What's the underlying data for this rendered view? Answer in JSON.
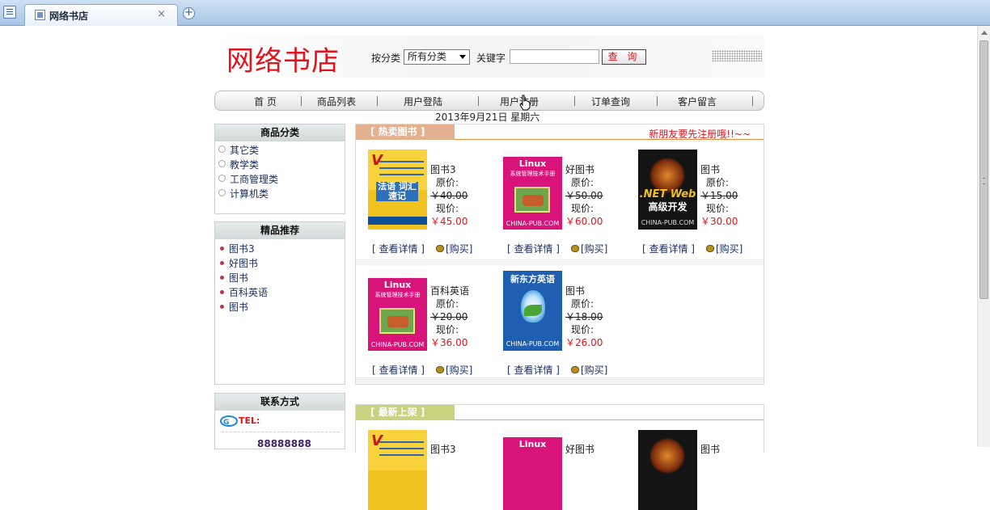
{
  "browser": {
    "tab_title": "网络书店",
    "tab_close": "×",
    "new_tab": "+"
  },
  "header": {
    "logo": "网络书店",
    "category_label": "按分类",
    "category_selected": "所有分类",
    "keyword_label": "关键字",
    "keyword_value": "",
    "query_button": "查 询"
  },
  "nav": {
    "items": [
      "首 页",
      "商品列表",
      "用户登陆",
      "用户注册",
      "订单查询",
      "客户留言"
    ]
  },
  "date_line": "2013年9月21日  星期六",
  "sidebar": {
    "categories_title": "商品分类",
    "categories": [
      "其它类",
      "教学类",
      "工商管理类",
      "计算机类"
    ],
    "recommend_title": "精品推荐",
    "recommend": [
      "图书3",
      "好图书",
      "图书",
      "百科英语",
      "图书"
    ],
    "contact_title": "联系方式",
    "tel_label": "TEL:",
    "tel_number": "88888888"
  },
  "hot_books": {
    "tag": "[ 热卖图书 ]",
    "note": "新朋友要先注册哦!!~~",
    "price_original_label": "原价:",
    "price_current_label": "现价:",
    "details_label": "[ 查看详情 ]",
    "buy_label": "[购买]",
    "books": [
      {
        "name": "图书3",
        "original": "￥40.00",
        "current": "￥45.00",
        "cover": "yellow"
      },
      {
        "name": "好图书",
        "original": "￥50.00",
        "current": "￥60.00",
        "cover": "pink"
      },
      {
        "name": "图书",
        "original": "￥15.00",
        "current": "￥30.00",
        "cover": "dark"
      },
      {
        "name": "百科英语",
        "original": "￥20.00",
        "current": "￥36.00",
        "cover": "pink"
      },
      {
        "name": "图书",
        "original": "￥18.00",
        "current": "￥26.00",
        "cover": "blue"
      }
    ]
  },
  "new_books": {
    "tag": "[ 最新上架 ]",
    "books": [
      {
        "name": "图书3",
        "cover": "yellow"
      },
      {
        "name": "好图书",
        "cover": "pink"
      },
      {
        "name": "图书",
        "cover": "dark"
      }
    ]
  },
  "covers": {
    "yellow": {
      "v": "V",
      "zh": "法语 词汇速记"
    },
    "pink": {
      "t1": "Linux",
      "t2": "系统管理技术手册",
      "url": "CHINA-PUB.COM"
    },
    "dark": {
      "net": ".NET Web",
      "dev": "高级开发",
      "url": "CHINA-PUB.COM"
    },
    "blue": {
      "hd": "新东方英语",
      "url": "CHINA-PUB.COM"
    }
  },
  "colors": {
    "brand_red": "#e0141c",
    "hot_tag": "#e3b090",
    "new_tag": "#c9d27e",
    "link_blue": "#1d2f63"
  }
}
